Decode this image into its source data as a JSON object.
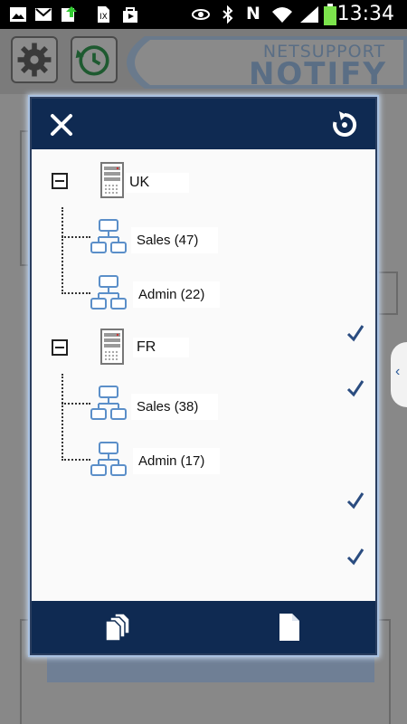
{
  "status_bar": {
    "time": "13:34",
    "carrier_letter": "N"
  },
  "app": {
    "brand_top": "NETSUPPORT",
    "brand_bottom": "NOTIFY",
    "accent_color": "#0f2a52"
  },
  "dialog": {
    "tree": [
      {
        "site": "UK",
        "groups": [
          {
            "label": "Sales (47)",
            "checked": true
          },
          {
            "label": "Admin (22)",
            "checked": true
          }
        ]
      },
      {
        "site": "FR",
        "groups": [
          {
            "label": "Sales (38)",
            "checked": true
          },
          {
            "label": "Admin (17)",
            "checked": true
          }
        ]
      }
    ]
  }
}
